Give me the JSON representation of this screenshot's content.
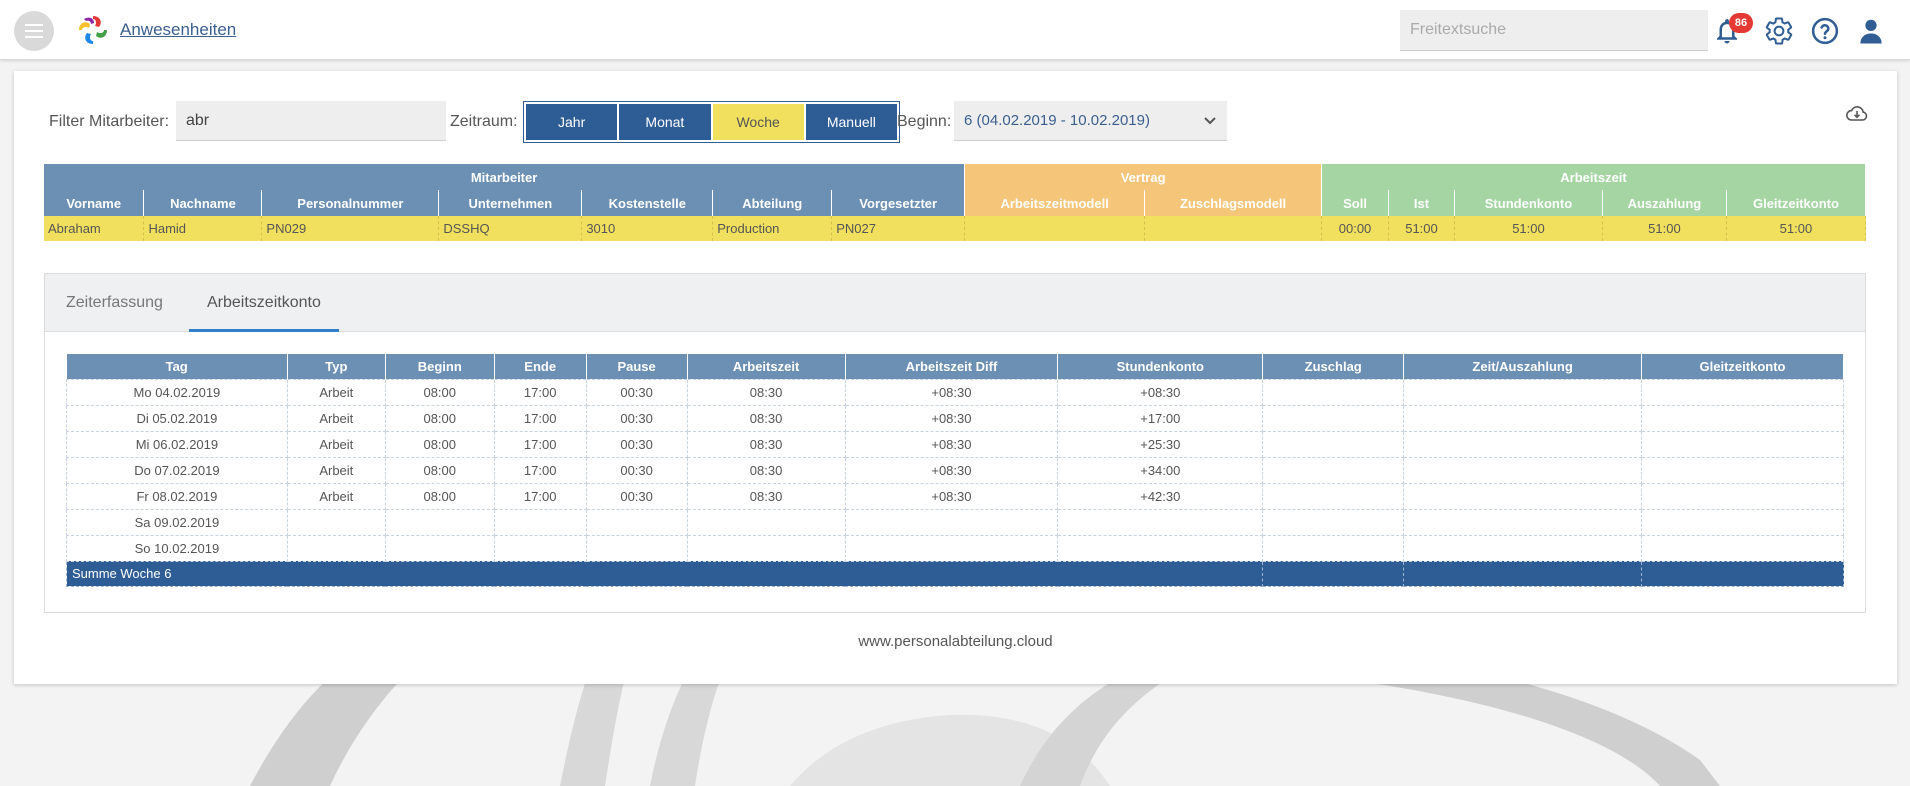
{
  "header": {
    "app_title": "Anwesenheiten",
    "search_placeholder": "Freitextsuche",
    "notification_count": "86",
    "icons": [
      "menu-icon",
      "logo",
      "bell-icon",
      "gear-icon",
      "help-icon",
      "user-icon"
    ]
  },
  "filter": {
    "employee_label": "Filter Mitarbeiter:",
    "employee_value": "abr",
    "period_label": "Zeitraum:",
    "periods": [
      "Jahr",
      "Monat",
      "Woche",
      "Manuell"
    ],
    "active_period": "Woche",
    "start_label": "Beginn:",
    "start_value": "6 (04.02.2019 - 10.02.2019)"
  },
  "employee_table": {
    "groups": [
      "Mitarbeiter",
      "Vertrag",
      "Arbeitszeit"
    ],
    "columns": [
      "Vorname",
      "Nachname",
      "Personalnummer",
      "Unternehmen",
      "Kostenstelle",
      "Abteilung",
      "Vorgesetzter",
      "Arbeitszeitmodell",
      "Zuschlagsmodell",
      "Soll",
      "Ist",
      "Stundenkonto",
      "Auszahlung",
      "Gleitzeitkonto"
    ],
    "row": [
      "Abraham",
      "Hamid",
      "PN029",
      "DSSHQ",
      "3010",
      "Production",
      "PN027",
      "",
      "",
      "00:00",
      "51:00",
      "51:00",
      "51:00",
      "51:00"
    ]
  },
  "tabs": [
    "Zeiterfassung",
    "Arbeitszeitkonto"
  ],
  "active_tab": "Arbeitszeitkonto",
  "days_table": {
    "columns": [
      "Tag",
      "Typ",
      "Beginn",
      "Ende",
      "Pause",
      "Arbeitszeit",
      "Arbeitszeit Diff",
      "Stundenkonto",
      "Zuschlag",
      "Zeit/Auszahlung",
      "Gleitzeitkonto"
    ],
    "rows": [
      [
        "Mo 04.02.2019",
        "Arbeit",
        "08:00",
        "17:00",
        "00:30",
        "08:30",
        "+08:30",
        "+08:30",
        "",
        "",
        ""
      ],
      [
        "Di 05.02.2019",
        "Arbeit",
        "08:00",
        "17:00",
        "00:30",
        "08:30",
        "+08:30",
        "+17:00",
        "",
        "",
        ""
      ],
      [
        "Mi 06.02.2019",
        "Arbeit",
        "08:00",
        "17:00",
        "00:30",
        "08:30",
        "+08:30",
        "+25:30",
        "",
        "",
        ""
      ],
      [
        "Do 07.02.2019",
        "Arbeit",
        "08:00",
        "17:00",
        "00:30",
        "08:30",
        "+08:30",
        "+34:00",
        "",
        "",
        ""
      ],
      [
        "Fr 08.02.2019",
        "Arbeit",
        "08:00",
        "17:00",
        "00:30",
        "08:30",
        "+08:30",
        "+42:30",
        "",
        "",
        ""
      ],
      [
        "Sa 09.02.2019",
        "",
        "",
        "",
        "",
        "",
        "",
        "",
        "",
        "",
        ""
      ],
      [
        "So 10.02.2019",
        "",
        "",
        "",
        "",
        "",
        "",
        "",
        "",
        "",
        ""
      ]
    ],
    "summary_label": "Summe Woche 6"
  },
  "footer": "www.personalabteilung.cloud"
}
